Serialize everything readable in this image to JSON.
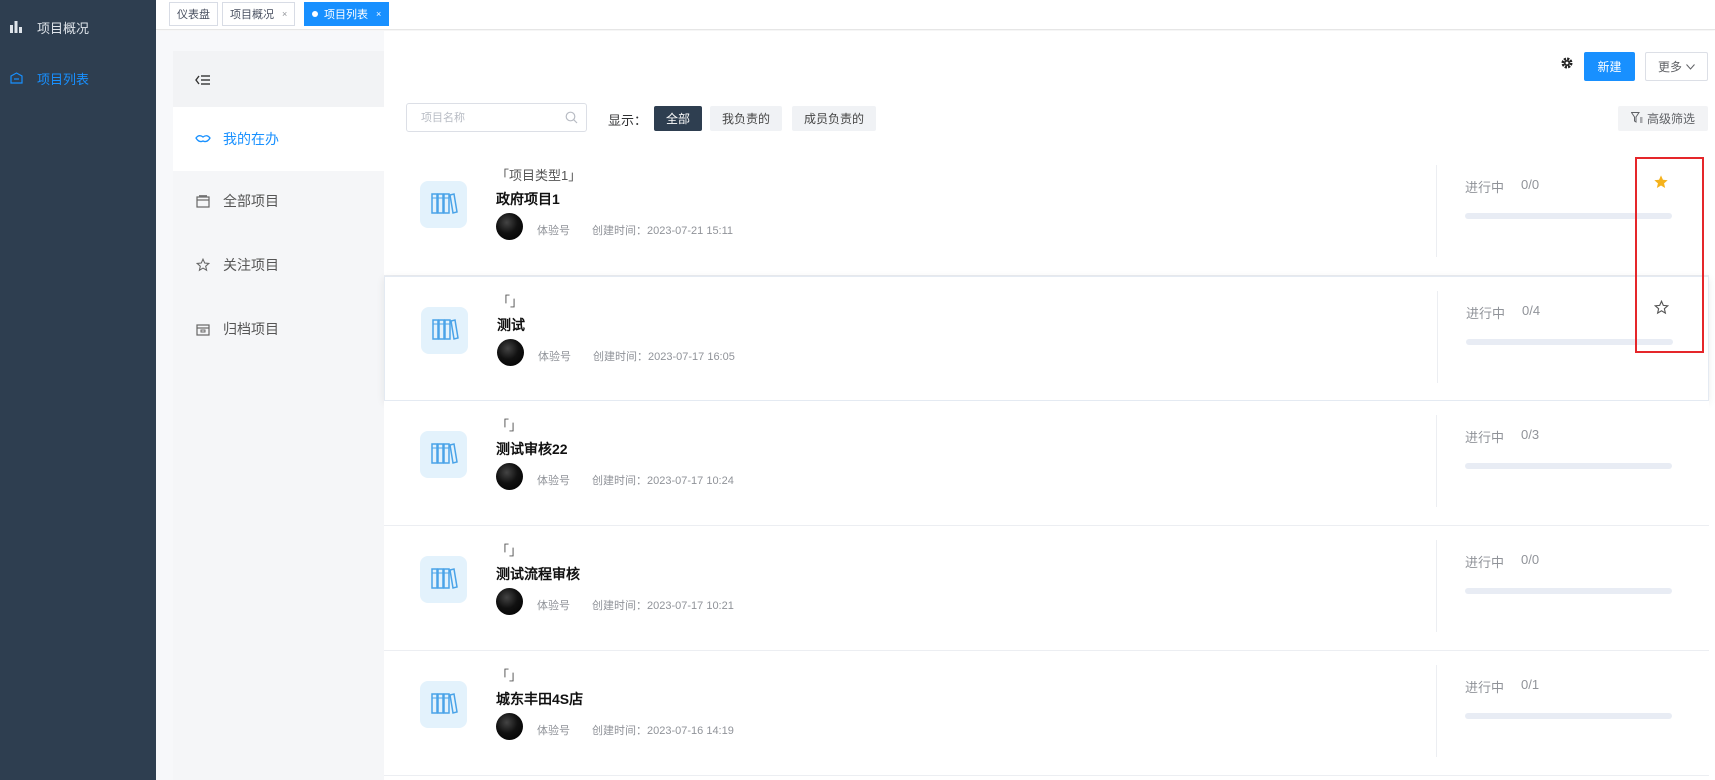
{
  "sidebar": {
    "items": [
      {
        "label": "项目概况",
        "icon": "bar-chart-icon",
        "active": false
      },
      {
        "label": "项目列表",
        "icon": "project-list-icon",
        "active": true
      }
    ]
  },
  "tabs": [
    {
      "label": "仪表盘",
      "closable": false,
      "active": false
    },
    {
      "label": "项目概况",
      "closable": true,
      "active": false
    },
    {
      "label": "项目列表",
      "closable": true,
      "active": true
    }
  ],
  "tab_close_glyph": "×",
  "toolbar": {
    "new_label": "新建",
    "more_label": "更多",
    "search_placeholder": "项目名称",
    "show_label": "显示：",
    "filters": [
      {
        "label": "全部",
        "active": true
      },
      {
        "label": "我负责的",
        "active": false
      },
      {
        "label": "成员负责的",
        "active": false
      }
    ],
    "advanced_filter_label": "高级筛选"
  },
  "subnav": {
    "collapse_icon": "collapse-menu-icon",
    "items": [
      {
        "label": "我的在办",
        "icon": "handshake-icon",
        "active": true
      },
      {
        "label": "全部项目",
        "icon": "folder-icon",
        "active": false
      },
      {
        "label": "关注项目",
        "icon": "star-outline-icon",
        "active": false
      },
      {
        "label": "归档项目",
        "icon": "archive-icon",
        "active": false
      }
    ]
  },
  "projects": [
    {
      "type": "「项目类型1」",
      "name": "政府项目1",
      "owner": "体验号",
      "created": "创建时间：2023-07-21 15:11",
      "status": "进行中",
      "progress": "0/0",
      "progress_fraction": 0,
      "starred": true
    },
    {
      "type": "「」",
      "name": "测试",
      "owner": "体验号",
      "created": "创建时间：2023-07-17 16:05",
      "status": "进行中",
      "progress": "0/4",
      "progress_fraction": 0,
      "starred": false
    },
    {
      "type": "「」",
      "name": "测试审核22",
      "owner": "体验号",
      "created": "创建时间：2023-07-17 10:24",
      "status": "进行中",
      "progress": "0/3",
      "progress_fraction": 0,
      "starred": null
    },
    {
      "type": "「」",
      "name": "测试流程审核",
      "owner": "体验号",
      "created": "创建时间：2023-07-17 10:21",
      "status": "进行中",
      "progress": "0/0",
      "progress_fraction": 0,
      "starred": null
    },
    {
      "type": "「」",
      "name": "城东丰田4S店",
      "owner": "体验号",
      "created": "创建时间：2023-07-16 14:19",
      "status": "进行中",
      "progress": "0/1",
      "progress_fraction": 0,
      "starred": null
    }
  ],
  "colors": {
    "sidebar_bg": "#2e3e50",
    "accent": "#1890ff",
    "star_filled": "#f5b21c",
    "highlight": "#e5262a"
  }
}
